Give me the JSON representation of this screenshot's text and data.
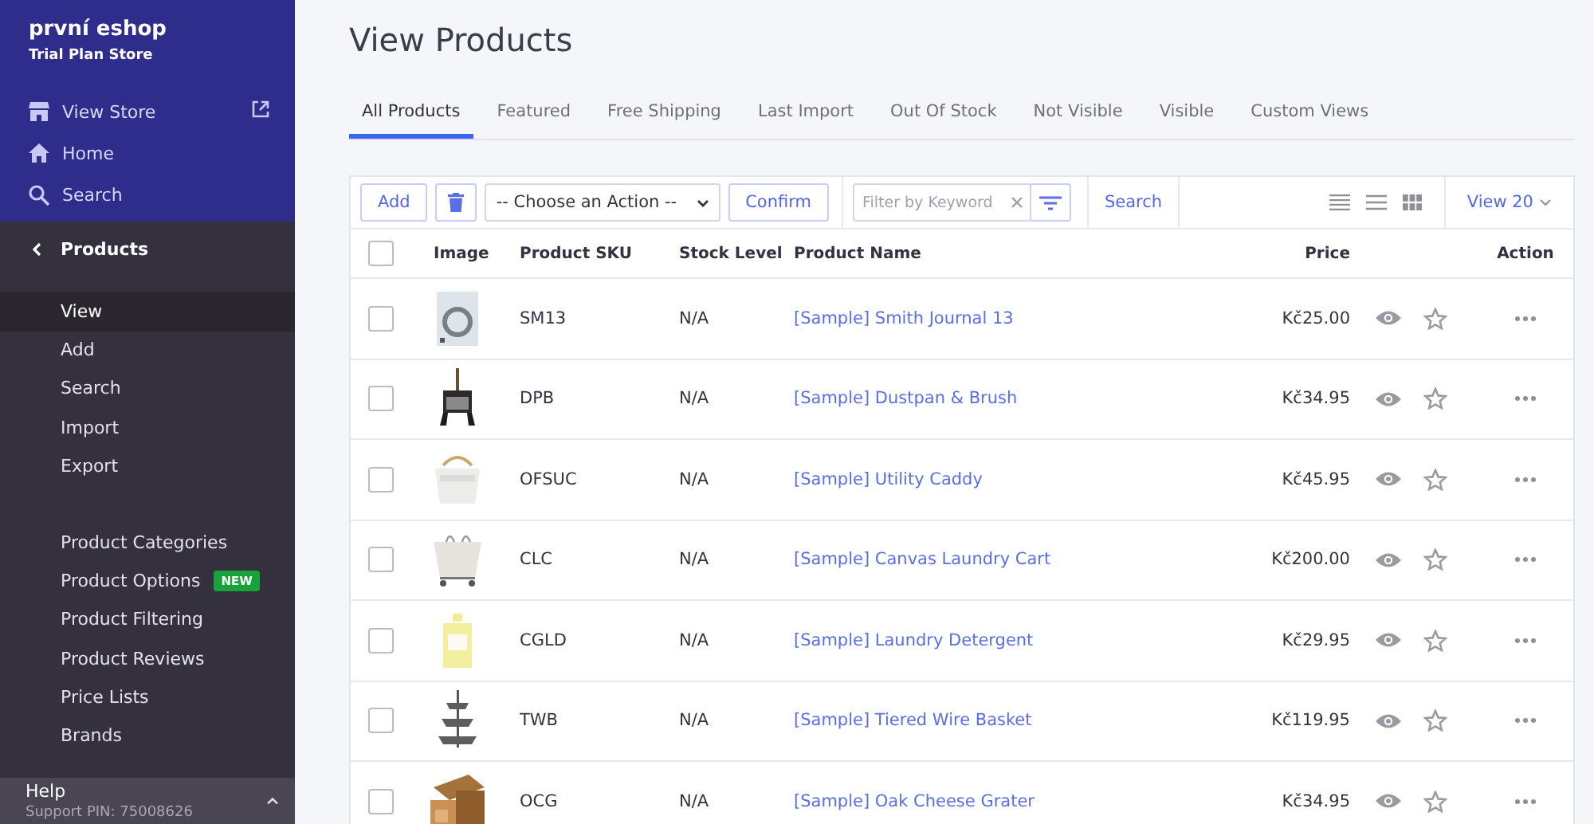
{
  "sidebar": {
    "store_name": "první eshop",
    "plan": "Trial Plan Store",
    "top_items": [
      {
        "kind": "store",
        "label": "View Store",
        "external": true
      },
      {
        "kind": "home",
        "label": "Home",
        "external": false
      },
      {
        "kind": "search",
        "label": "Search",
        "external": false
      }
    ],
    "section": {
      "label": "Products"
    },
    "groups": [
      [
        {
          "label": "View",
          "selected": true
        },
        {
          "label": "Add",
          "selected": false
        },
        {
          "label": "Search",
          "selected": false
        },
        {
          "label": "Import",
          "selected": false
        },
        {
          "label": "Export",
          "selected": false
        }
      ],
      [
        {
          "label": "Product Categories",
          "selected": false
        },
        {
          "label": "Product Options",
          "selected": false,
          "badge": "NEW"
        },
        {
          "label": "Product Filtering",
          "selected": false
        },
        {
          "label": "Product Reviews",
          "selected": false
        },
        {
          "label": "Price Lists",
          "selected": false
        },
        {
          "label": "Brands",
          "selected": false
        }
      ]
    ],
    "help": {
      "label": "Help",
      "pin": "Support PIN: 75008626"
    }
  },
  "page_title": "View Products",
  "tabs": [
    {
      "label": "All Products",
      "selected": true
    },
    {
      "label": "Featured",
      "selected": false
    },
    {
      "label": "Free Shipping",
      "selected": false
    },
    {
      "label": "Last Import",
      "selected": false
    },
    {
      "label": "Out Of Stock",
      "selected": false
    },
    {
      "label": "Not Visible",
      "selected": false
    },
    {
      "label": "Visible",
      "selected": false
    },
    {
      "label": "Custom Views",
      "selected": false
    }
  ],
  "toolbar": {
    "add": "Add",
    "action": "-- Choose an Action --",
    "confirm": "Confirm",
    "filter": {
      "placeholder": "Filter by Keyword"
    },
    "search": "Search",
    "view_count": "View 20"
  },
  "table": {
    "header_checked": false,
    "columns": [
      "Image",
      "Product SKU",
      "Stock Level",
      "Product Name",
      "Price",
      "Action"
    ],
    "rows": [
      {
        "checked": false,
        "kind": "picture",
        "sku": "SM13",
        "stock": "N/A",
        "name": "[Sample] Smith Journal 13",
        "price": "Kč25.00",
        "featured": false
      },
      {
        "checked": false,
        "kind": "picture",
        "sku": "DPB",
        "stock": "N/A",
        "name": "[Sample] Dustpan & Brush",
        "price": "Kč34.95",
        "featured": false
      },
      {
        "checked": false,
        "kind": "picture",
        "sku": "OFSUC",
        "stock": "N/A",
        "name": "[Sample] Utility Caddy",
        "price": "Kč45.95",
        "featured": false
      },
      {
        "checked": false,
        "kind": "picture",
        "sku": "CLC",
        "stock": "N/A",
        "name": "[Sample] Canvas Laundry Cart",
        "price": "Kč200.00",
        "featured": false
      },
      {
        "checked": false,
        "kind": "picture",
        "sku": "CGLD",
        "stock": "N/A",
        "name": "[Sample] Laundry Detergent",
        "price": "Kč29.95",
        "featured": false
      },
      {
        "checked": false,
        "kind": "picture",
        "sku": "TWB",
        "stock": "N/A",
        "name": "[Sample] Tiered Wire Basket",
        "price": "Kč119.95",
        "featured": false
      },
      {
        "checked": false,
        "kind": "picture",
        "sku": "OCG",
        "stock": "N/A",
        "name": "[Sample] Oak Cheese Grater",
        "price": "Kč34.95",
        "featured": false
      }
    ]
  }
}
